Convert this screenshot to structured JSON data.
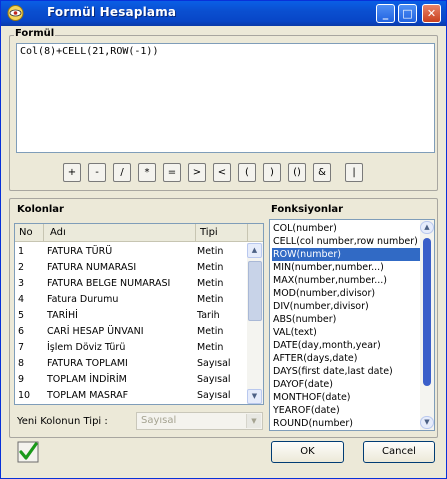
{
  "window": {
    "title": "Formül Hesaplama"
  },
  "formula": {
    "group_title": "Formül",
    "value": "Col(8)+CELL(21,ROW(-1))"
  },
  "operators": [
    "+",
    "-",
    "/",
    "*",
    "=",
    ">",
    "<",
    "(",
    ")",
    "()",
    "&",
    "|"
  ],
  "columns": {
    "group_title": "Kolonlar",
    "headers": [
      "No",
      "Adı",
      "Tipi"
    ],
    "rows": [
      [
        "1",
        "FATURA TÜRÜ",
        "Metin"
      ],
      [
        "2",
        "FATURA NUMARASI",
        "Metin"
      ],
      [
        "3",
        "FATURA BELGE NUMARASI",
        "Metin"
      ],
      [
        "4",
        "Fatura Durumu",
        "Metin"
      ],
      [
        "5",
        "TARİHİ",
        "Tarih"
      ],
      [
        "6",
        "CARİ HESAP ÜNVANI",
        "Metin"
      ],
      [
        "7",
        "İşlem Döviz Türü",
        "Metin"
      ],
      [
        "8",
        "FATURA TOPLAMI",
        "Sayısal"
      ],
      [
        "9",
        "TOPLAM İNDİRİM",
        "Sayısal"
      ],
      [
        "10",
        "TOPLAM MASRAF",
        "Sayısal"
      ]
    ],
    "new_type_label": "Yeni Kolonun Tipi :",
    "new_type_value": "Sayısal"
  },
  "functions": {
    "group_title": "Fonksiyonlar",
    "items": [
      "COL(number)",
      "CELL(col number,row number)",
      "ROW(number)",
      "MIN(number,number...)",
      "MAX(number,number...)",
      "MOD(number,divisor)",
      "DIV(number,divisor)",
      "ABS(number)",
      "VAL(text)",
      "DATE(day,month,year)",
      "AFTER(days,date)",
      "DAYS(first date,last date)",
      "DAYOF(date)",
      "MONTHOF(date)",
      "YEAROF(date)",
      "ROUND(number)"
    ],
    "selected_index": 2
  },
  "buttons": {
    "ok": "OK",
    "cancel": "Cancel"
  },
  "colors": {
    "titlebar": "#0a4fd0",
    "selection": "#316ac5",
    "dialog_bg": "#ece9d8"
  },
  "icons": {
    "app": "eye-app-icon",
    "check": "green-check-icon"
  }
}
